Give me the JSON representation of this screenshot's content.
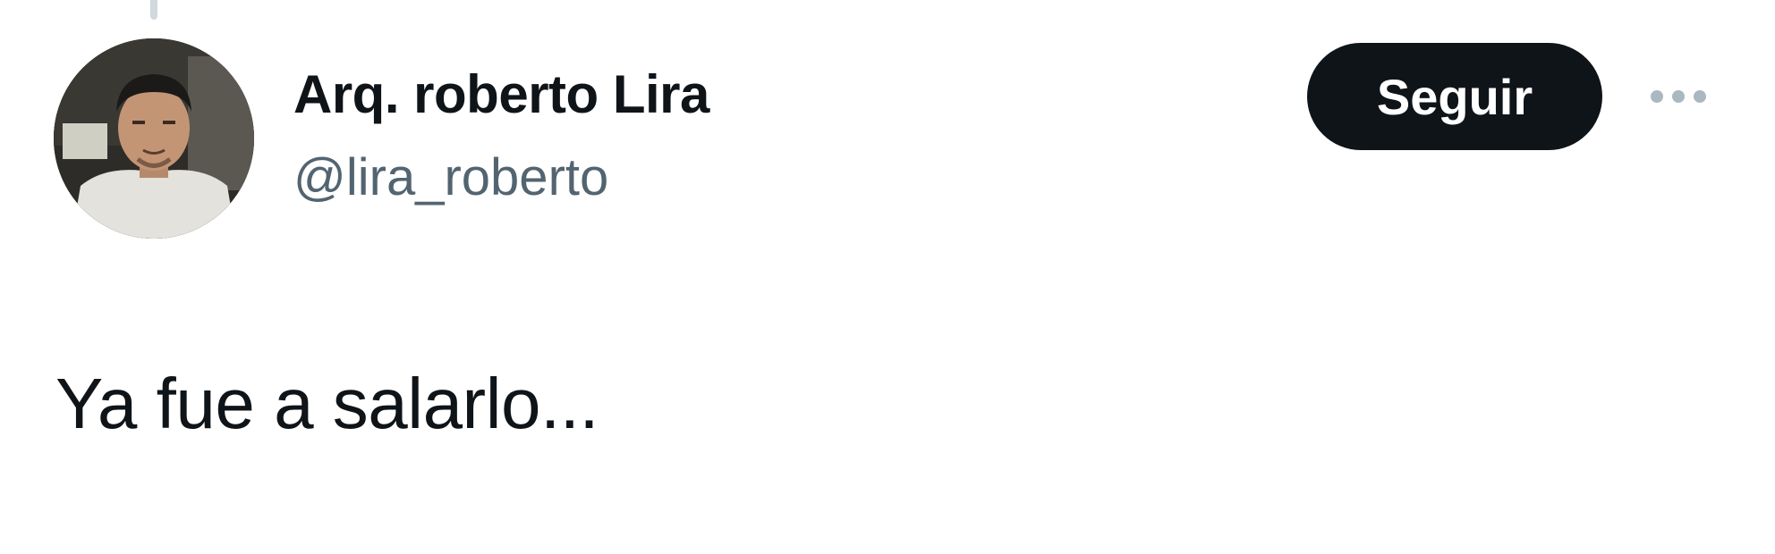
{
  "tweet": {
    "author": {
      "display_name": "Arq. roberto Lira",
      "handle": "@lira_roberto",
      "avatar_icon": "user-photo-avatar"
    },
    "follow_label": "Seguir",
    "more_icon": "more-horizontal-icon",
    "text": "Ya fue a salarlo..."
  },
  "colors": {
    "text_primary": "#0f1419",
    "text_secondary": "#536471",
    "button_bg": "#0f1419",
    "button_text": "#ffffff",
    "more_dots": "#aab8c2"
  }
}
